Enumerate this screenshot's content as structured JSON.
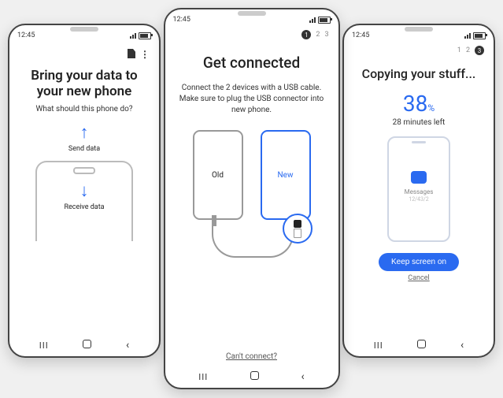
{
  "status": {
    "time": "12:45"
  },
  "left": {
    "title_l1": "Bring your data to",
    "title_l2": "your new phone",
    "subtitle": "What should this phone do?",
    "send_label": "Send data",
    "receive_label": "Receive data"
  },
  "center": {
    "steps": {
      "current": "1",
      "s2": "2",
      "s3": "3"
    },
    "title": "Get connected",
    "desc": "Connect the 2 devices with a USB cable. Make sure to plug the USB connector into new phone.",
    "old_label": "Old",
    "new_label": "New",
    "cant_connect": "Can't connect?"
  },
  "right": {
    "steps": {
      "s1": "1",
      "s2": "2",
      "current": "3"
    },
    "title": "Copying your stuff...",
    "percent": "38",
    "percent_unit": "%",
    "eta": "28 minutes left",
    "category": "Messages",
    "count": "12/43/2",
    "keep_btn": "Keep screen on",
    "cancel": "Cancel"
  }
}
